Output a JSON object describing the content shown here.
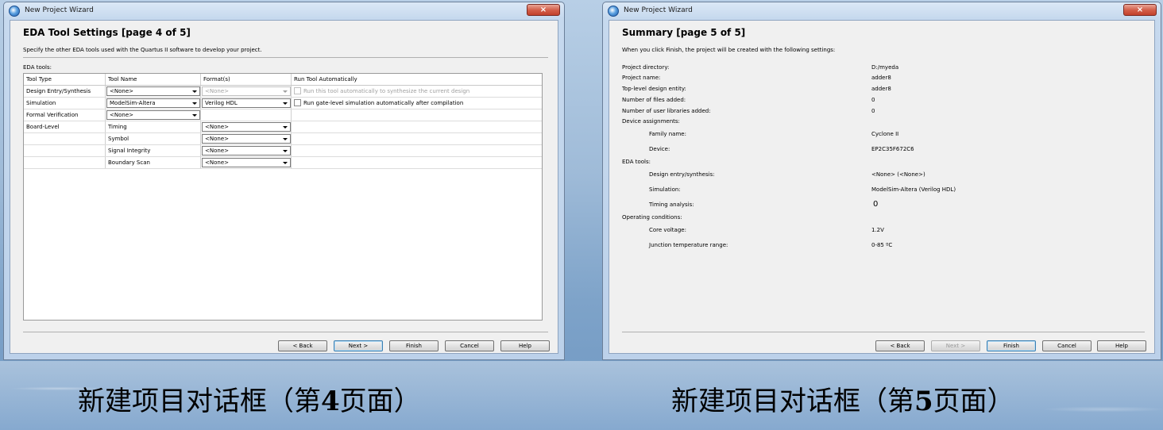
{
  "colors": {
    "close_button": "#d4604b",
    "window_frame": "#c6d9ee",
    "dialog_bg": "#f0f0f0"
  },
  "window1": {
    "title": "New Project Wizard",
    "close_icon": "×",
    "page_title": "EDA Tool Settings [page 4 of 5]",
    "description": "Specify the other EDA tools used with the Quartus II software to develop your project.",
    "eda_tools_label": "EDA tools:",
    "table": {
      "headers": [
        "Tool Type",
        "Tool Name",
        "Format(s)",
        "Run Tool Automatically"
      ],
      "rows": [
        {
          "tool_type": "Design Entry/Synthesis",
          "tool_name": "<None>",
          "format": "<None>",
          "format_disabled": true,
          "run_text": "Run this tool automatically to synthesize the current design",
          "run_disabled": true
        },
        {
          "tool_type": "Simulation",
          "tool_name": "ModelSim-Altera",
          "format": "Verilog HDL",
          "format_disabled": false,
          "run_text": "Run gate-level simulation automatically after compilation",
          "run_disabled": false
        },
        {
          "tool_type": "Formal Verification",
          "tool_name": "<None>"
        },
        {
          "tool_type": "Board-Level",
          "tool_name": "Timing",
          "format": "<None>"
        },
        {
          "tool_type": "",
          "tool_name": "Symbol",
          "format": "<None>"
        },
        {
          "tool_type": "",
          "tool_name": "Signal Integrity",
          "format": "<None>"
        },
        {
          "tool_type": "",
          "tool_name": "Boundary Scan",
          "format": "<None>"
        }
      ]
    },
    "buttons": {
      "back": "< Back",
      "next": "Next >",
      "finish": "Finish",
      "cancel": "Cancel",
      "help": "Help"
    }
  },
  "window2": {
    "title": "New Project Wizard",
    "close_icon": "×",
    "page_title": "Summary [page 5 of 5]",
    "description": "When you click Finish, the project will be created with the following settings:",
    "summary": [
      {
        "label": "Project directory:",
        "value": "D:/myeda"
      },
      {
        "label": "Project name:",
        "value": "adder8"
      },
      {
        "label": "Top-level design entity:",
        "value": "adder8"
      },
      {
        "label": "Number of files added:",
        "value": "0"
      },
      {
        "label": "Number of user libraries added:",
        "value": "0"
      },
      {
        "label": "Device assignments:",
        "value": ""
      },
      {
        "label": "Family name:",
        "value": "Cyclone II"
      },
      {
        "label": "Device:",
        "value": "EP2C35F672C6"
      },
      {
        "label": "EDA tools:",
        "value": ""
      },
      {
        "label": "Design entry/synthesis:",
        "value": "<None> (<None>)"
      },
      {
        "label": "Simulation:",
        "value": "ModelSim-Altera (Verilog HDL)"
      },
      {
        "label": "Timing analysis:",
        "value": "0"
      },
      {
        "label": "Operating conditions:",
        "value": ""
      },
      {
        "label": "Core voltage:",
        "value": "1.2V"
      },
      {
        "label": "Junction temperature range:",
        "value": "0-85 ºC"
      }
    ],
    "buttons": {
      "back": "< Back",
      "next": "Next >",
      "finish": "Finish",
      "cancel": "Cancel",
      "help": "Help"
    }
  },
  "captions": {
    "left_prefix": "新建项目对话框（第",
    "left_num": "4",
    "left_suffix": "页面）",
    "right_prefix": "新建项目对话框（第",
    "right_num": "5",
    "right_suffix": "页面）"
  }
}
